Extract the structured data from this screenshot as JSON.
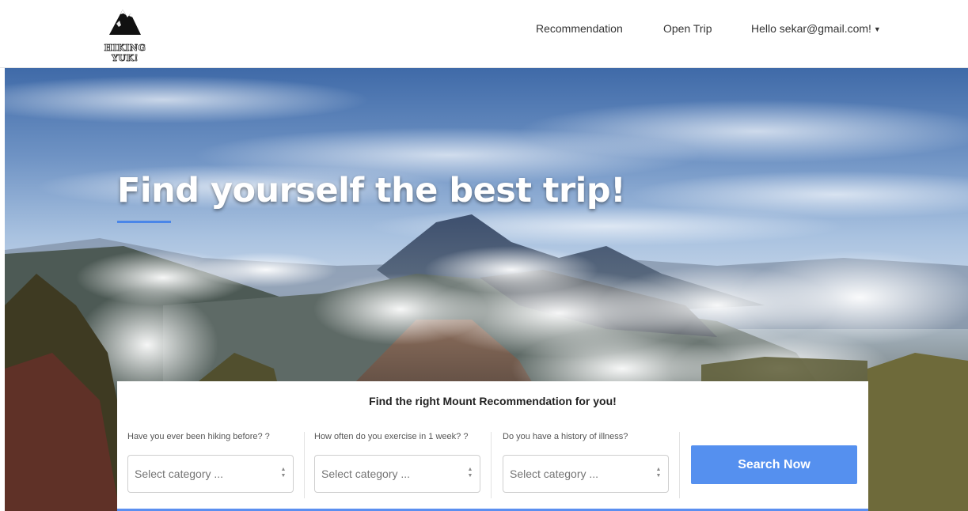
{
  "brand": {
    "logo_text": "HIKING YUK!",
    "icon": "mountain-icon"
  },
  "nav": {
    "items": [
      {
        "label": "Recommendation"
      },
      {
        "label": "Open Trip"
      }
    ],
    "user_label": "Hello sekar@gmail.com!",
    "user_menu_icon": "caret-down-icon"
  },
  "hero": {
    "title": "Find yourself the best trip!"
  },
  "search_panel": {
    "title": "Find the right Mount Recommendation for you!",
    "fields": [
      {
        "label": "Have you ever been hiking before? ?",
        "placeholder": "Select category ..."
      },
      {
        "label": "How often do you exercise in 1 week? ?",
        "placeholder": "Select category ..."
      },
      {
        "label": "Do you have a history of illness?",
        "placeholder": "Select category ..."
      }
    ],
    "button_label": "Search Now"
  },
  "colors": {
    "accent": "#5590ef",
    "nav_text": "#333333",
    "hero_title": "#ffffff"
  }
}
